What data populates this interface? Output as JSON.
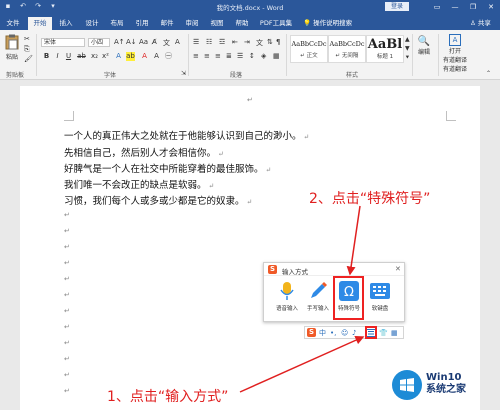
{
  "window": {
    "title": "我的文档.docx - Word",
    "signin_label": "登录",
    "minimize_glyph": "—",
    "restore_glyph": "❐",
    "close_glyph": "✕"
  },
  "tabs": [
    {
      "label": "文件"
    },
    {
      "label": "开始"
    },
    {
      "label": "插入"
    },
    {
      "label": "设计"
    },
    {
      "label": "布局"
    },
    {
      "label": "引用"
    },
    {
      "label": "邮件"
    },
    {
      "label": "审阅"
    },
    {
      "label": "视图"
    },
    {
      "label": "帮助"
    },
    {
      "label": "PDF工具集"
    }
  ],
  "tellme": "操作说明搜索",
  "share": "共享",
  "ribbon": {
    "paste_label": "粘贴",
    "font_name": "宋体",
    "font_size": "小四",
    "styles": [
      {
        "sample": "AaBbCcDc",
        "name": "↵ 正文"
      },
      {
        "sample": "AaBbCcDc",
        "name": "↵ 无间隔"
      },
      {
        "sample": "AaBl",
        "name": "标题 1"
      }
    ],
    "edit_label": "编辑",
    "open_label": "打开",
    "translate1": "有道翻译",
    "translate2": "有道翻译",
    "groups": {
      "clipboard": "剪贴板",
      "font": "字体",
      "paragraph": "段落",
      "styles": "样式",
      "translate": "有道翻译"
    }
  },
  "document": {
    "lines": [
      "一个人的真正伟大之处就在于他能够认识到自己的渺小。",
      "先相信自己，然后别人才会相信你。",
      "好脾气是一个人在社交中所能穿着的最佳服饰。",
      "我们唯一不会改正的缺点是软弱。",
      "习惯，我们每个人或多或少都是它的奴隶。"
    ],
    "para_mark": "↵"
  },
  "ime_panel": {
    "title": "输入方式",
    "close": "✕",
    "tools": [
      {
        "label": "语音输入",
        "icon": "microphone-icon"
      },
      {
        "label": "手写输入",
        "icon": "pen-icon"
      },
      {
        "label": "特殊符号",
        "icon": "omega-icon"
      },
      {
        "label": "软键盘",
        "icon": "keyboard-icon"
      }
    ]
  },
  "ime_bar": {
    "lang": "中",
    "punct": "•,",
    "emoji": "☺",
    "mic": "♪"
  },
  "annotations": {
    "step1": "1、点击“输入方式”",
    "step2": "2、点击“特殊符号”"
  },
  "watermark": {
    "brand": "Win10",
    "sub": "系统之家"
  },
  "colors": {
    "word_blue": "#2b579a",
    "annotation_red": "#e02020",
    "sogou_orange": "#f05a28",
    "accent_blue": "#2e8ae6"
  }
}
